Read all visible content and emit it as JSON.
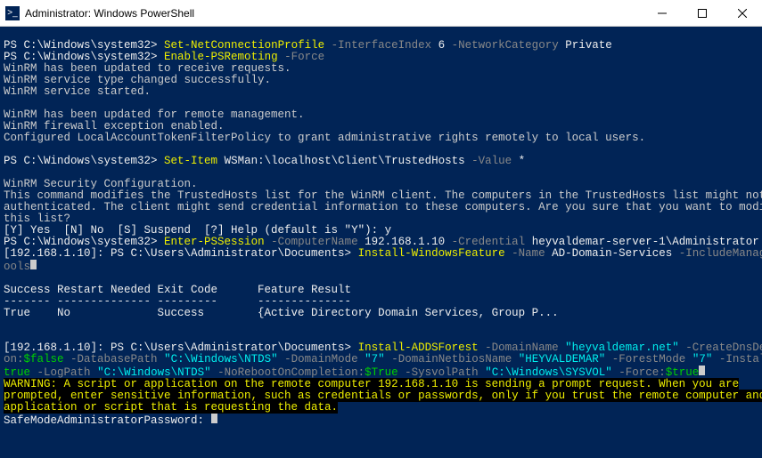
{
  "window": {
    "icon_text": ">_",
    "title": "Administrator: Windows PowerShell"
  },
  "prompt": "PS C:\\Windows\\system32>",
  "remote_prompt": "[192.168.1.10]: PS C:\\Users\\Administrator\\Documents>",
  "cmd1": {
    "cmdlet": "Set-NetConnectionProfile",
    "p_interfaceindex": "-InterfaceIndex",
    "v_interfaceindex": "6",
    "p_netcat": "-NetworkCategory",
    "v_netcat": "Private"
  },
  "cmd2": {
    "cmdlet": "Enable-PSRemoting",
    "p_force": "-Force"
  },
  "out_enable": {
    "l1": "WinRM has been updated to receive requests.",
    "l2": "WinRM service type changed successfully.",
    "l3": "WinRM service started.",
    "l4": "WinRM has been updated for remote management.",
    "l5": "WinRM firewall exception enabled.",
    "l6": "Configured LocalAccountTokenFilterPolicy to grant administrative rights remotely to local users."
  },
  "cmd3": {
    "cmdlet": "Set-Item",
    "arg_path": "WSMan:\\localhost\\Client\\TrustedHosts",
    "p_value": "-Value",
    "v_value": "*"
  },
  "sec": {
    "l1": "WinRM Security Configuration.",
    "l2": "This command modifies the TrustedHosts list for the WinRM client. The computers in the TrustedHosts list might not be",
    "l3": "authenticated. The client might send credential information to these computers. Are you sure that you want to modify",
    "l4": "this list?",
    "choices": "[Y] Yes  [N] No  [S] Suspend  [?] Help (default is \"Y\"): y"
  },
  "cmd4": {
    "cmdlet": "Enter-PSSession",
    "p_cn": "-ComputerName",
    "v_cn": "192.168.1.10",
    "p_cred": "-Credential",
    "v_cred": "heyvaldemar-server-1\\Administrator"
  },
  "cmd5": {
    "cmdlet": "Install-WindowsFeature",
    "p_name": "-Name",
    "v_name": "AD-Domain-Services",
    "p_imt": "-IncludeManagementT",
    "p_imt_wrap": "ools"
  },
  "table": {
    "hdr": "Success Restart Needed Exit Code      Feature Result",
    "sep": "------- -------------- ---------      --------------",
    "row": "True    No             Success        {Active Directory Domain Services, Group P..."
  },
  "cmd6": {
    "cmdlet": "Install-ADDSForest",
    "p_dn": "-DomainName",
    "v_dn": "\"heyvaldemar.net\"",
    "p_cdd": "-CreateDnsDelegati",
    "p_cdd_wrap": "on:",
    "v_cdd": "$false",
    "p_dbp": "-DatabasePath",
    "v_dbp": "\"C:\\Windows\\NTDS\"",
    "p_dm": "-DomainMode",
    "v_dm": "\"7\"",
    "p_dnb": "-DomainNetbiosName",
    "v_dnb": "\"HEYVALDEMAR\"",
    "p_fm": "-ForestMode",
    "v_fm": "\"7\"",
    "p_id": "-InstallDns:",
    "v_id": "$",
    "v_id_wrap": "true",
    "p_lp": "-LogPath",
    "v_lp": "\"C:\\Windows\\NTDS\"",
    "p_nrc": "-NoRebootOnCompletion:",
    "v_nrc": "$True",
    "p_sp": "-SysvolPath",
    "v_sp": "\"C:\\Windows\\SYSVOL\"",
    "p_force": "-Force:",
    "v_force": "$true"
  },
  "warning": {
    "l1": "WARNING: A script or application on the remote computer 192.168.1.10 is sending a prompt request. When you are",
    "l2": "prompted, enter sensitive information, such as credentials or passwords, only if you trust the remote computer and the",
    "l3": "application or script that is requesting the data."
  },
  "safemode": "SafeModeAdministratorPassword: "
}
